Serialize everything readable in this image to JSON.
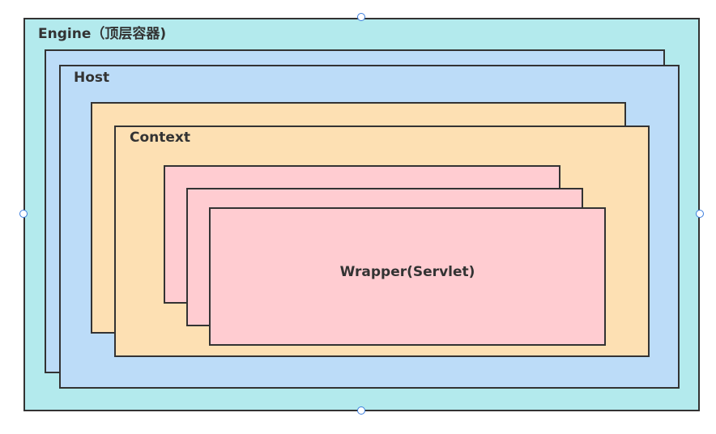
{
  "diagram": {
    "engine_label": "Engine（顶层容器)",
    "host_label": "Host",
    "context_label": "Context",
    "wrapper_label": "Wrapper(Servlet)"
  },
  "colors": {
    "engine_fill": "#b3eaed",
    "host_fill": "#bcdcf8",
    "context_fill": "#fde0b3",
    "wrapper_fill": "#ffccd1",
    "border": "#333333",
    "selection_handle": "#3b7ddd"
  }
}
